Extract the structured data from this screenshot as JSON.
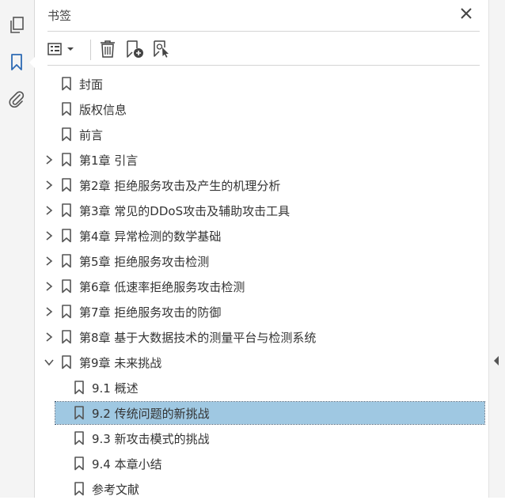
{
  "panel": {
    "title": "书签"
  },
  "icons": {
    "rail": [
      "pages-icon",
      "bookmark-icon",
      "attachment-icon"
    ],
    "toolbar": [
      "options-menu-icon",
      "delete-icon",
      "new-bookmark-icon",
      "bookmark-from-selection-icon"
    ]
  },
  "colors": {
    "accent": "#2d6ab4",
    "selection": "#9fc8e2"
  },
  "bookmarks": [
    {
      "label": "封面",
      "level": 0,
      "expandable": false
    },
    {
      "label": "版权信息",
      "level": 0,
      "expandable": false
    },
    {
      "label": "前言",
      "level": 0,
      "expandable": false
    },
    {
      "label": "第1章 引言",
      "level": 0,
      "expandable": true,
      "expanded": false
    },
    {
      "label": "第2章 拒绝服务攻击及产生的机理分析",
      "level": 0,
      "expandable": true,
      "expanded": false
    },
    {
      "label": "第3章 常见的DDoS攻击及辅助攻击工具",
      "level": 0,
      "expandable": true,
      "expanded": false
    },
    {
      "label": "第4章 异常检测的数学基础",
      "level": 0,
      "expandable": true,
      "expanded": false
    },
    {
      "label": "第5章 拒绝服务攻击检测",
      "level": 0,
      "expandable": true,
      "expanded": false
    },
    {
      "label": "第6章 低速率拒绝服务攻击检测",
      "level": 0,
      "expandable": true,
      "expanded": false
    },
    {
      "label": "第7章 拒绝服务攻击的防御",
      "level": 0,
      "expandable": true,
      "expanded": false
    },
    {
      "label": "第8章 基于大数据技术的测量平台与检测系统",
      "level": 0,
      "expandable": true,
      "expanded": false
    },
    {
      "label": "第9章 未来挑战",
      "level": 0,
      "expandable": true,
      "expanded": true
    },
    {
      "label": "9.1 概述",
      "level": 1,
      "expandable": false
    },
    {
      "label": "9.2 传统问题的新挑战",
      "level": 1,
      "expandable": false,
      "selected": true
    },
    {
      "label": "9.3 新攻击模式的挑战",
      "level": 1,
      "expandable": false
    },
    {
      "label": "9.4 本章小结",
      "level": 1,
      "expandable": false
    },
    {
      "label": "参考文献",
      "level": 1,
      "expandable": false
    }
  ]
}
